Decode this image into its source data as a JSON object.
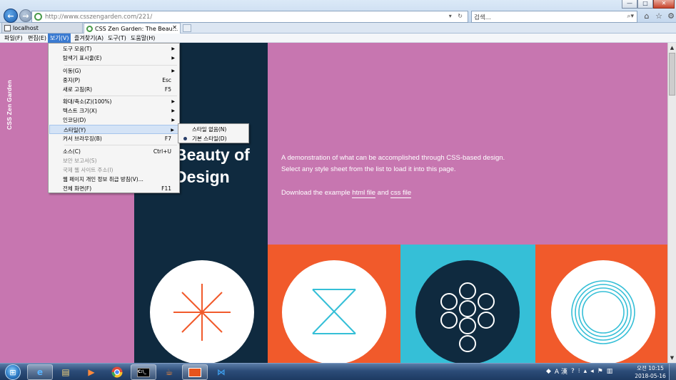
{
  "browser": {
    "address_url": "http://www.csszengarden.com/221/",
    "address_controls": "▾ ↻",
    "search_placeholder": "검색...",
    "search_controls": "⌕▾",
    "window_controls": [
      "—",
      "□",
      "✕"
    ],
    "toolbar_icons": [
      "home-icon",
      "star-icon",
      "gear-icon"
    ]
  },
  "tabs": [
    {
      "label": "localhost",
      "active": false
    },
    {
      "label": "CSS Zen Garden: The Beau...",
      "active": true
    }
  ],
  "menubar": [
    "파일(F)",
    "편집(E)",
    "보기(V)",
    "즐겨찾기(A)",
    "도구(T)",
    "도움말(H)"
  ],
  "view_menu": {
    "items": [
      {
        "label": "도구 모음(T)",
        "submenu": true
      },
      {
        "label": "탐색기 표시줄(E)",
        "submenu": true
      },
      {
        "label": "이동(G)",
        "submenu": true
      },
      {
        "label": "중지(P)",
        "shortcut": "Esc"
      },
      {
        "label": "새로 고침(R)",
        "shortcut": "F5"
      },
      {
        "label": "확대/축소(Z)(100%)",
        "submenu": true
      },
      {
        "label": "텍스트 크기(X)",
        "submenu": true
      },
      {
        "label": "인코딩(D)",
        "submenu": true
      },
      {
        "label": "스타일(Y)",
        "submenu": true,
        "highlighted": true
      },
      {
        "label": "커서 브라우징(B)",
        "shortcut": "F7"
      },
      {
        "label": "소스(C)",
        "shortcut": "Ctrl+U"
      },
      {
        "label": "보안 보고서(S)",
        "disabled": true
      },
      {
        "label": "국제 웹 사이트 주소(I)",
        "disabled": true
      },
      {
        "label": "웹 페이지 개인 정보 취급 방침(V)..."
      },
      {
        "label": "전체 화면(F)",
        "shortcut": "F11"
      }
    ]
  },
  "style_menu": {
    "items": [
      {
        "label": "스타일 없음(N)",
        "selected": false
      },
      {
        "label": "기본 스타일(D)",
        "selected": true
      }
    ]
  },
  "page": {
    "side_title": "CSS Zen Garden",
    "headline_line1": "Beauty of",
    "headline_line2": "Design",
    "intro_line1": "A demonstration of what can be accomplished through CSS-based design.",
    "intro_line2": "Select any style sheet from the list to load it into this page.",
    "download_prefix": "Download the example ",
    "html_link": "html file",
    "and_word": " and ",
    "css_link": "css file",
    "colors": {
      "pink": "#c776b0",
      "navy": "#0f2a3f",
      "orange": "#f15a2b",
      "cyan": "#35bfd7",
      "white": "#ffffff"
    }
  },
  "taskbar": {
    "apps": [
      "internet-explorer-icon",
      "file-explorer-icon",
      "media-player-icon",
      "chrome-icon",
      "command-prompt-icon",
      "java-icon",
      "editor-icon",
      "visual-studio-code-icon"
    ],
    "tray_text": "A 漢",
    "clock_time": "오전 10:15",
    "clock_date": "2018-05-16"
  }
}
